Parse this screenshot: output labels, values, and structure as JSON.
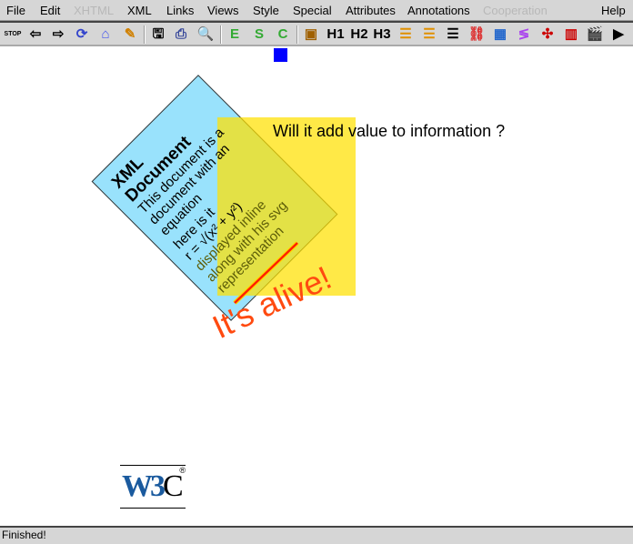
{
  "menubar": {
    "items": [
      {
        "label": "File",
        "enabled": true
      },
      {
        "label": "Edit",
        "enabled": true
      },
      {
        "label": "XHTML",
        "enabled": false
      },
      {
        "label": "XML",
        "enabled": true
      },
      {
        "label": "Links",
        "enabled": true
      },
      {
        "label": "Views",
        "enabled": true
      },
      {
        "label": "Style",
        "enabled": true
      },
      {
        "label": "Special",
        "enabled": true
      },
      {
        "label": "Attributes",
        "enabled": true
      },
      {
        "label": "Annotations",
        "enabled": true
      },
      {
        "label": "Cooperation",
        "enabled": false
      },
      {
        "label": "Help",
        "enabled": true
      }
    ]
  },
  "toolbar": {
    "icons": [
      {
        "name": "stop-icon",
        "glyph": "STOP"
      },
      {
        "name": "back-icon",
        "glyph": "⇦"
      },
      {
        "name": "forward-icon",
        "glyph": "⇨"
      },
      {
        "name": "reload-icon",
        "glyph": "⟳"
      },
      {
        "name": "home-icon",
        "glyph": "⌂"
      },
      {
        "name": "edit-pencil-icon",
        "glyph": "✎"
      },
      {
        "name": "save-icon",
        "glyph": "🖫"
      },
      {
        "name": "print-icon",
        "glyph": "⎙"
      },
      {
        "name": "find-icon",
        "glyph": "🔍"
      },
      {
        "name": "emphasis-icon",
        "glyph": "E"
      },
      {
        "name": "strong-icon",
        "glyph": "S"
      },
      {
        "name": "code-icon",
        "glyph": "C"
      },
      {
        "name": "image-icon",
        "glyph": "▣"
      },
      {
        "name": "heading1-icon",
        "glyph": "H1"
      },
      {
        "name": "heading2-icon",
        "glyph": "H2"
      },
      {
        "name": "heading3-icon",
        "glyph": "H3"
      },
      {
        "name": "bulleted-list-icon",
        "glyph": "☰"
      },
      {
        "name": "numbered-list-icon",
        "glyph": "☰"
      },
      {
        "name": "definition-list-icon",
        "glyph": "☰"
      },
      {
        "name": "link-icon",
        "glyph": "⛓"
      },
      {
        "name": "table-icon",
        "glyph": "▦"
      },
      {
        "name": "math-icon",
        "glyph": "≶"
      },
      {
        "name": "graphics-icon",
        "glyph": "✣"
      },
      {
        "name": "chart-icon",
        "glyph": "▥"
      },
      {
        "name": "movie-icon",
        "glyph": "🎬"
      },
      {
        "name": "play-icon",
        "glyph": "▶"
      }
    ]
  },
  "document": {
    "card": {
      "title1": "XML",
      "title2": "Document",
      "lines": [
        "This document is a",
        "document with an",
        "equation",
        "here is it"
      ],
      "equation": "r = √(x² + y²)",
      "lines2": [
        "displayed inline",
        "along with his svg",
        "representation"
      ]
    },
    "question": "Will it add value to information ?",
    "alive": "It's alive!",
    "logo": "W3C",
    "colors": {
      "card": "#99e2fc",
      "overlay": "#ffe000",
      "alive": "#ff4a10",
      "square": "#0000ff"
    }
  },
  "status": "Finished!"
}
